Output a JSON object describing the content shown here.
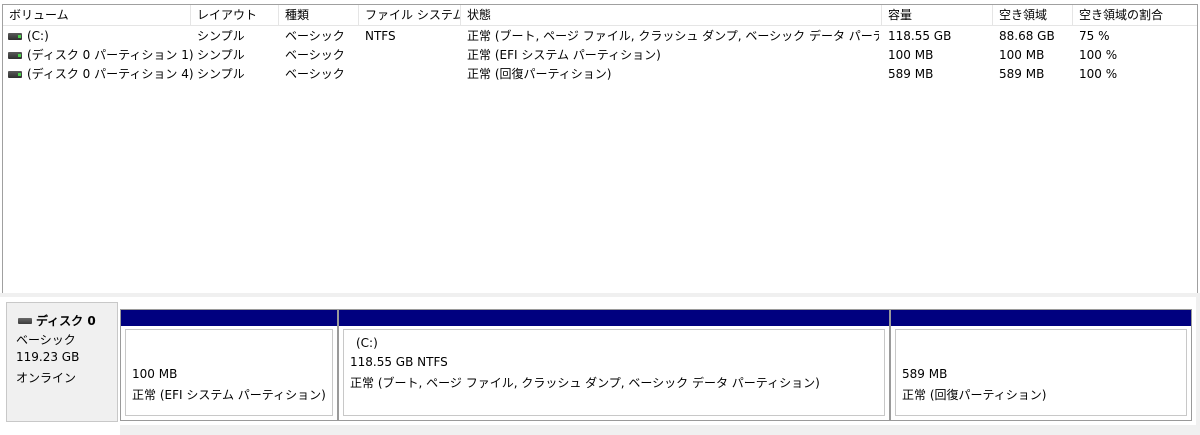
{
  "columns": [
    "ボリューム",
    "レイアウト",
    "種類",
    "ファイル システム",
    "状態",
    "容量",
    "空き領域",
    "空き領域の割合"
  ],
  "volumes": [
    {
      "name": "(C:)",
      "layout": "シンプル",
      "type": "ベーシック",
      "fs": "NTFS",
      "status": "正常 (ブート, ページ ファイル, クラッシュ ダンプ, ベーシック データ パーティション)",
      "capacity": "118.55 GB",
      "free": "88.68 GB",
      "percent": "75 %",
      "icon": "volume-icon"
    },
    {
      "name": "(ディスク 0 パーティション 1)",
      "layout": "シンプル",
      "type": "ベーシック",
      "fs": "",
      "status": "正常 (EFI システム パーティション)",
      "capacity": "100 MB",
      "free": "100 MB",
      "percent": "100 %",
      "icon": "volume-icon"
    },
    {
      "name": "(ディスク 0 パーティション 4)",
      "layout": "シンプル",
      "type": "ベーシック",
      "fs": "",
      "status": "正常 (回復パーティション)",
      "capacity": "589 MB",
      "free": "589 MB",
      "percent": "100 %",
      "icon": "volume-icon"
    }
  ],
  "disk": {
    "name": "ディスク 0",
    "type": "ベーシック",
    "size": "119.23 GB",
    "state": "オンライン",
    "icon": "disk-icon"
  },
  "partitions": [
    {
      "title": "",
      "size": "100 MB",
      "status": "正常 (EFI システム パーティション)"
    },
    {
      "title": "(C:)",
      "size": "118.55 GB NTFS",
      "status": "正常 (ブート, ページ ファイル, クラッシュ ダンプ, ベーシック データ パーティション)"
    },
    {
      "title": "",
      "size": "589 MB",
      "status": "正常 (回復パーティション)"
    }
  ],
  "colors": {
    "partition_bar": "#00007f",
    "panel_bg": "#f0f0f0"
  }
}
